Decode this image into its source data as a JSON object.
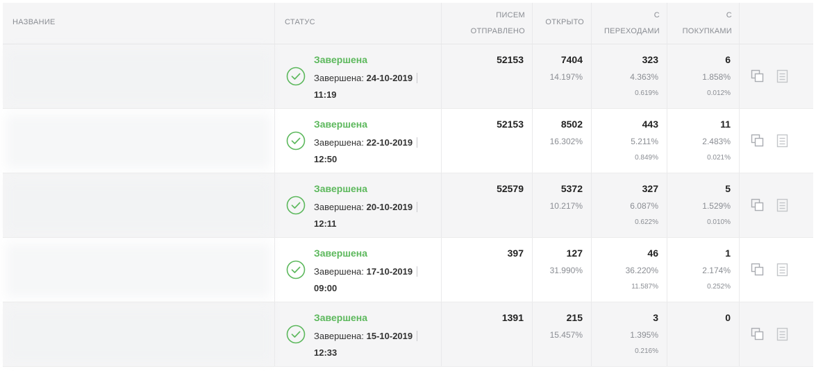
{
  "headers": {
    "name": "НАЗВАНИЕ",
    "status": "СТАТУС",
    "sent": [
      "ПИСЕМ",
      "ОТПРАВЛЕНО"
    ],
    "opened": "ОТКРЫТО",
    "clicks": [
      "С",
      "ПЕРЕХОДАМИ"
    ],
    "purchases": [
      "С",
      "ПОКУПКАМИ"
    ]
  },
  "colors": {
    "accent_green": "#5cb85c",
    "muted": "#8a8d93",
    "row_alt": "#f5f5f6"
  },
  "icons": {
    "status": "check-circle-icon",
    "copy": "copy-icon",
    "report": "document-icon"
  },
  "rows": [
    {
      "status": "Завершена",
      "finished_label": "Завершена:",
      "date": "24-10-2019",
      "time": "11:19",
      "sent": "52153",
      "opened": "7404",
      "opened_pct": "14.197%",
      "clicks": "323",
      "clicks_pct": "4.363%",
      "clicks_pct2": "0.619%",
      "purchases": "6",
      "purchases_pct": "1.858%",
      "purchases_pct2": "0.012%"
    },
    {
      "status": "Завершена",
      "finished_label": "Завершена:",
      "date": "22-10-2019",
      "time": "12:50",
      "sent": "52153",
      "opened": "8502",
      "opened_pct": "16.302%",
      "clicks": "443",
      "clicks_pct": "5.211%",
      "clicks_pct2": "0.849%",
      "purchases": "11",
      "purchases_pct": "2.483%",
      "purchases_pct2": "0.021%"
    },
    {
      "status": "Завершена",
      "finished_label": "Завершена:",
      "date": "20-10-2019",
      "time": "12:11",
      "sent": "52579",
      "opened": "5372",
      "opened_pct": "10.217%",
      "clicks": "327",
      "clicks_pct": "6.087%",
      "clicks_pct2": "0.622%",
      "purchases": "5",
      "purchases_pct": "1.529%",
      "purchases_pct2": "0.010%"
    },
    {
      "status": "Завершена",
      "finished_label": "Завершена:",
      "date": "17-10-2019",
      "time": "09:00",
      "sent": "397",
      "opened": "127",
      "opened_pct": "31.990%",
      "clicks": "46",
      "clicks_pct": "36.220%",
      "clicks_pct2": "11.587%",
      "purchases": "1",
      "purchases_pct": "2.174%",
      "purchases_pct2": "0.252%"
    },
    {
      "status": "Завершена",
      "finished_label": "Завершена:",
      "date": "15-10-2019",
      "time": "12:33",
      "sent": "1391",
      "opened": "215",
      "opened_pct": "15.457%",
      "clicks": "3",
      "clicks_pct": "1.395%",
      "clicks_pct2": "0.216%",
      "purchases": "0",
      "purchases_pct": "",
      "purchases_pct2": ""
    }
  ]
}
